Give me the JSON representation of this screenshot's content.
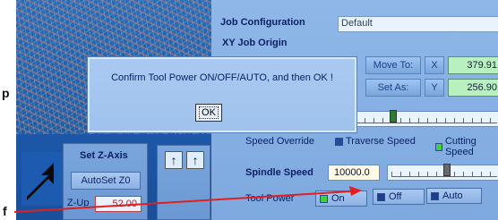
{
  "annotations": {
    "left_letter_top": "p",
    "left_letter_bottom": "f"
  },
  "job": {
    "config_label": "Job Configuration",
    "config_value": "Default",
    "xy_origin_label": "XY Job Origin",
    "move_to_label": "Move To:",
    "set_as_label": "Set As:",
    "x_label": "X",
    "y_label": "Y",
    "x_value": "379.91",
    "y_value": "256.90"
  },
  "speed": {
    "override_label": "Speed Override",
    "traverse_label": "Traverse Speed",
    "cutting_label": "Cutting Speed",
    "override_partial_value": "0"
  },
  "spindle": {
    "label": "Spindle Speed",
    "value": "10000.0"
  },
  "tool_power": {
    "label": "Tool Power",
    "on_label": "On",
    "off_label": "Off",
    "auto_label": "Auto"
  },
  "zaxis": {
    "title": "Set Z-Axis",
    "autoset_label": "AutoSet Z0",
    "zup_label": "Z-Up",
    "zup_value": "52.00"
  },
  "dialog": {
    "message": "Confirm Tool Power ON/OFF/AUTO, and then OK !",
    "ok_label": "OK"
  },
  "colors": {
    "screen_blue": "#1d5bb0",
    "panel_blue": "#8fb8e8",
    "field_green": "#b8f0c0",
    "annotation_red": "#e02020",
    "ok_checked_green": "#3cd23c"
  }
}
